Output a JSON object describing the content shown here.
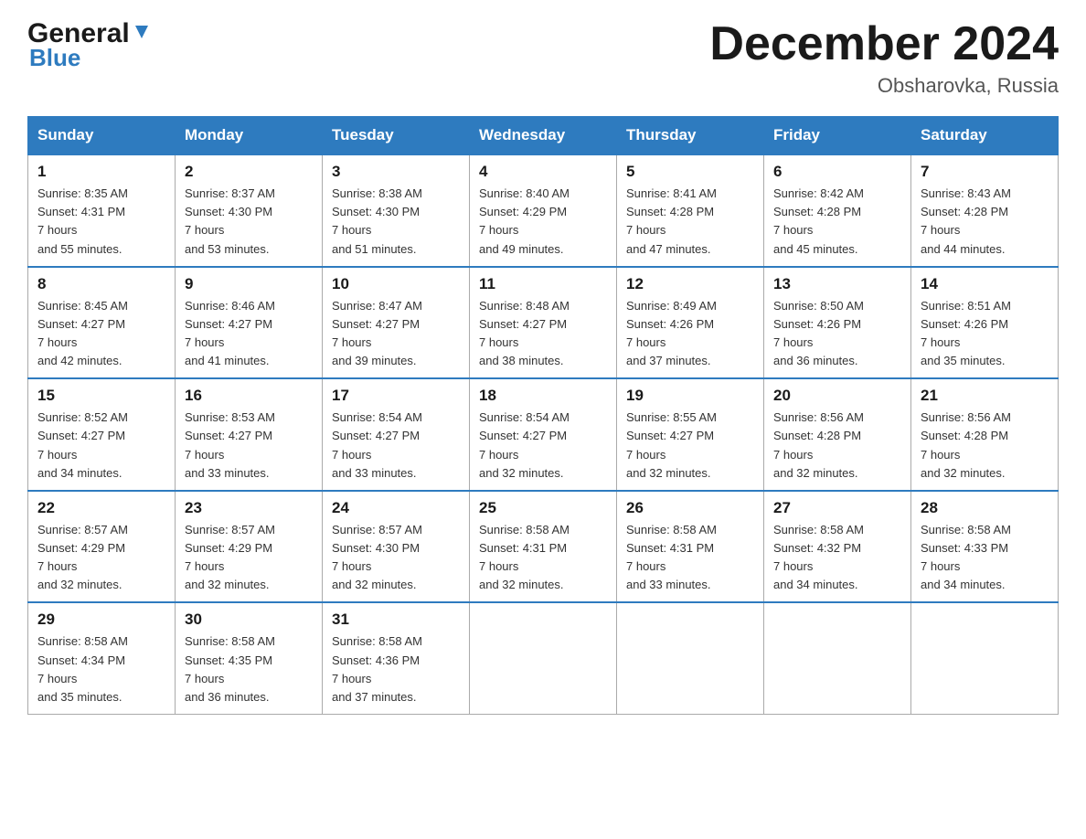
{
  "logo": {
    "general": "General",
    "triangle": "▼",
    "blue": "Blue"
  },
  "title": "December 2024",
  "location": "Obsharovka, Russia",
  "days_of_week": [
    "Sunday",
    "Monday",
    "Tuesday",
    "Wednesday",
    "Thursday",
    "Friday",
    "Saturday"
  ],
  "weeks": [
    [
      {
        "day": "1",
        "sunrise": "8:35 AM",
        "sunset": "4:31 PM",
        "daylight": "7 hours and 55 minutes."
      },
      {
        "day": "2",
        "sunrise": "8:37 AM",
        "sunset": "4:30 PM",
        "daylight": "7 hours and 53 minutes."
      },
      {
        "day": "3",
        "sunrise": "8:38 AM",
        "sunset": "4:30 PM",
        "daylight": "7 hours and 51 minutes."
      },
      {
        "day": "4",
        "sunrise": "8:40 AM",
        "sunset": "4:29 PM",
        "daylight": "7 hours and 49 minutes."
      },
      {
        "day": "5",
        "sunrise": "8:41 AM",
        "sunset": "4:28 PM",
        "daylight": "7 hours and 47 minutes."
      },
      {
        "day": "6",
        "sunrise": "8:42 AM",
        "sunset": "4:28 PM",
        "daylight": "7 hours and 45 minutes."
      },
      {
        "day": "7",
        "sunrise": "8:43 AM",
        "sunset": "4:28 PM",
        "daylight": "7 hours and 44 minutes."
      }
    ],
    [
      {
        "day": "8",
        "sunrise": "8:45 AM",
        "sunset": "4:27 PM",
        "daylight": "7 hours and 42 minutes."
      },
      {
        "day": "9",
        "sunrise": "8:46 AM",
        "sunset": "4:27 PM",
        "daylight": "7 hours and 41 minutes."
      },
      {
        "day": "10",
        "sunrise": "8:47 AM",
        "sunset": "4:27 PM",
        "daylight": "7 hours and 39 minutes."
      },
      {
        "day": "11",
        "sunrise": "8:48 AM",
        "sunset": "4:27 PM",
        "daylight": "7 hours and 38 minutes."
      },
      {
        "day": "12",
        "sunrise": "8:49 AM",
        "sunset": "4:26 PM",
        "daylight": "7 hours and 37 minutes."
      },
      {
        "day": "13",
        "sunrise": "8:50 AM",
        "sunset": "4:26 PM",
        "daylight": "7 hours and 36 minutes."
      },
      {
        "day": "14",
        "sunrise": "8:51 AM",
        "sunset": "4:26 PM",
        "daylight": "7 hours and 35 minutes."
      }
    ],
    [
      {
        "day": "15",
        "sunrise": "8:52 AM",
        "sunset": "4:27 PM",
        "daylight": "7 hours and 34 minutes."
      },
      {
        "day": "16",
        "sunrise": "8:53 AM",
        "sunset": "4:27 PM",
        "daylight": "7 hours and 33 minutes."
      },
      {
        "day": "17",
        "sunrise": "8:54 AM",
        "sunset": "4:27 PM",
        "daylight": "7 hours and 33 minutes."
      },
      {
        "day": "18",
        "sunrise": "8:54 AM",
        "sunset": "4:27 PM",
        "daylight": "7 hours and 32 minutes."
      },
      {
        "day": "19",
        "sunrise": "8:55 AM",
        "sunset": "4:27 PM",
        "daylight": "7 hours and 32 minutes."
      },
      {
        "day": "20",
        "sunrise": "8:56 AM",
        "sunset": "4:28 PM",
        "daylight": "7 hours and 32 minutes."
      },
      {
        "day": "21",
        "sunrise": "8:56 AM",
        "sunset": "4:28 PM",
        "daylight": "7 hours and 32 minutes."
      }
    ],
    [
      {
        "day": "22",
        "sunrise": "8:57 AM",
        "sunset": "4:29 PM",
        "daylight": "7 hours and 32 minutes."
      },
      {
        "day": "23",
        "sunrise": "8:57 AM",
        "sunset": "4:29 PM",
        "daylight": "7 hours and 32 minutes."
      },
      {
        "day": "24",
        "sunrise": "8:57 AM",
        "sunset": "4:30 PM",
        "daylight": "7 hours and 32 minutes."
      },
      {
        "day": "25",
        "sunrise": "8:58 AM",
        "sunset": "4:31 PM",
        "daylight": "7 hours and 32 minutes."
      },
      {
        "day": "26",
        "sunrise": "8:58 AM",
        "sunset": "4:31 PM",
        "daylight": "7 hours and 33 minutes."
      },
      {
        "day": "27",
        "sunrise": "8:58 AM",
        "sunset": "4:32 PM",
        "daylight": "7 hours and 34 minutes."
      },
      {
        "day": "28",
        "sunrise": "8:58 AM",
        "sunset": "4:33 PM",
        "daylight": "7 hours and 34 minutes."
      }
    ],
    [
      {
        "day": "29",
        "sunrise": "8:58 AM",
        "sunset": "4:34 PM",
        "daylight": "7 hours and 35 minutes."
      },
      {
        "day": "30",
        "sunrise": "8:58 AM",
        "sunset": "4:35 PM",
        "daylight": "7 hours and 36 minutes."
      },
      {
        "day": "31",
        "sunrise": "8:58 AM",
        "sunset": "4:36 PM",
        "daylight": "7 hours and 37 minutes."
      },
      null,
      null,
      null,
      null
    ]
  ]
}
